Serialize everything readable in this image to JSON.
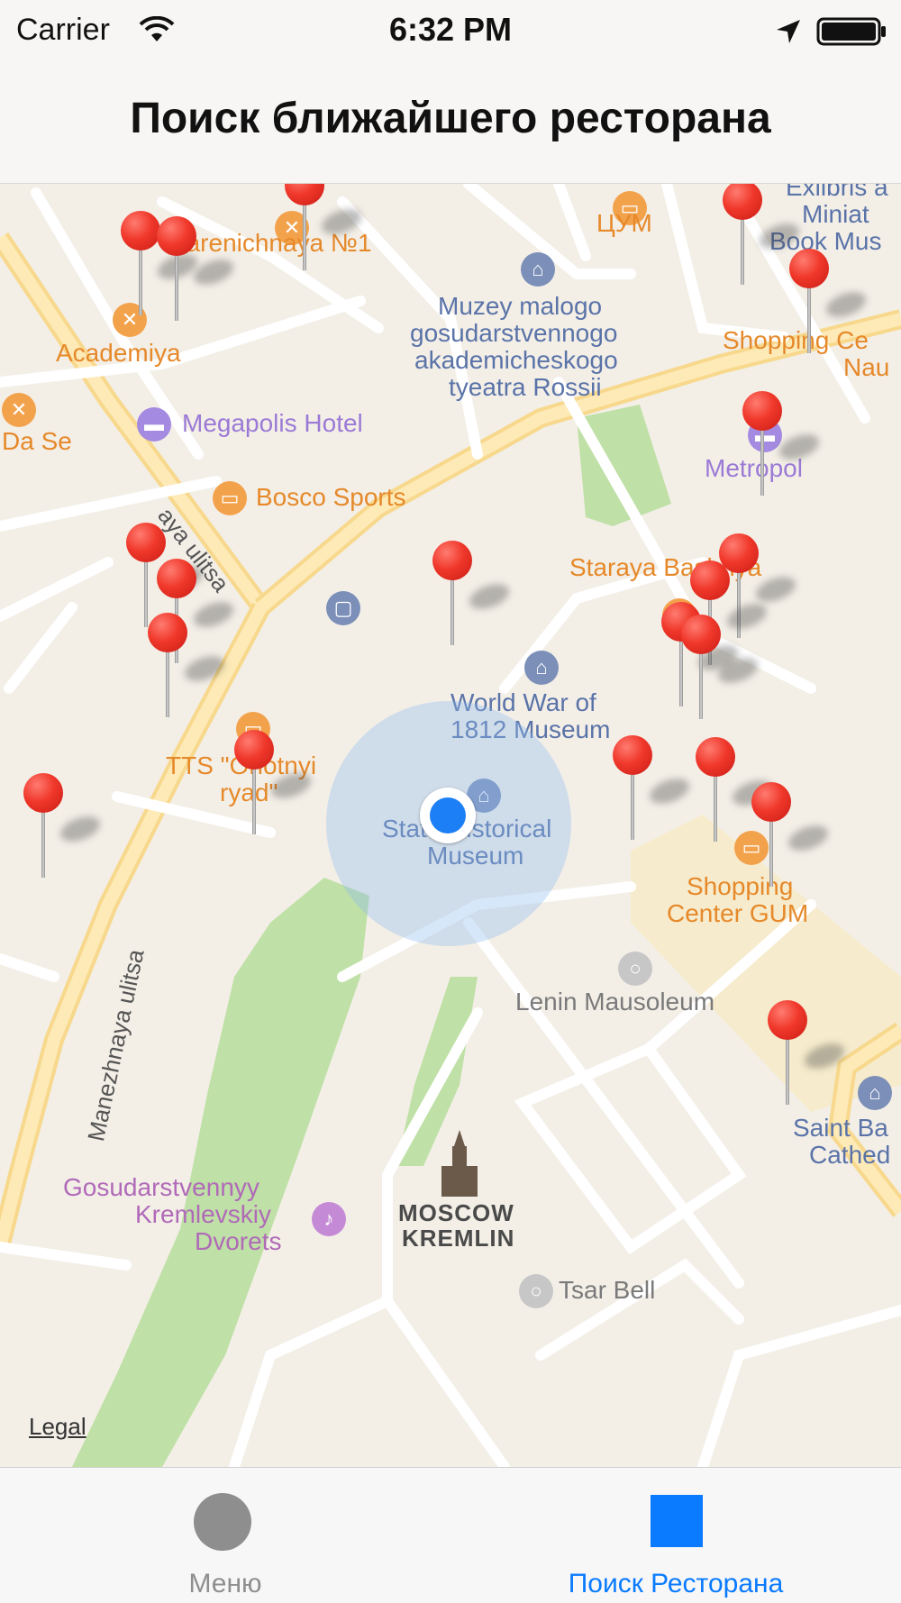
{
  "status_bar": {
    "carrier": "Carrier",
    "time": "6:32 PM",
    "icons": [
      "wifi-icon",
      "location-arrow-icon",
      "battery-icon"
    ]
  },
  "nav": {
    "title": "Поиск ближайшего ресторана"
  },
  "map": {
    "legal": "Legal",
    "labels": {
      "varenichnaya": "Varenichnaya №1",
      "tsum": "ЦУМ",
      "exlibris1": "Exlibris a",
      "exlibris2": "Miniat",
      "exlibris3": "Book Mus",
      "muzey1": "Muzey malogo",
      "muzey2": "gosudarstvennogo",
      "muzey3": "akademicheskogo",
      "muzey4": "tyeatra Rossii",
      "academiya": "Academiya",
      "shopping1": "Shopping Ce",
      "shopping2": "Nau",
      "megapolis": "Megapolis Hotel",
      "dase": "Da Se",
      "metropol": "Metropol",
      "bosco": "Bosco Sports",
      "street1": "aya ulitsa",
      "staraya": "Staraya Bashnya",
      "wwm1": "World War of",
      "wwm2": "1812 Museum",
      "tts1": "TTS \"Ohotnyi",
      "tts2": "ryad\"",
      "shm1": "State Historical",
      "shm2": "Museum",
      "gum1": "Shopping",
      "gum2": "Center GUM",
      "lenin": "Lenin Mausoleum",
      "manezh": "Manezhnaya ulitsa",
      "saint1": "Saint Ba",
      "saint2": "Cathed",
      "kremlin1": "MOSCOW",
      "kremlin2": "KREMLIN",
      "dvorets1": "Gosudarstvennyy",
      "dvorets2": "Kremlevskiy",
      "dvorets3": "Dvorets",
      "tsar": "Tsar Bell"
    },
    "pin_count": 21,
    "colors": {
      "pin": "#f0382b",
      "user_location": "#1d7ff5",
      "park": "#bfe0a6"
    }
  },
  "tabbar": {
    "tabs": [
      {
        "label": "Меню",
        "icon": "circle-icon",
        "selected": false
      },
      {
        "label": "Поиск Ресторана",
        "icon": "square-icon",
        "selected": true
      }
    ],
    "colors": {
      "selected": "#0a7bff",
      "unselected": "#8e8e8e"
    }
  }
}
